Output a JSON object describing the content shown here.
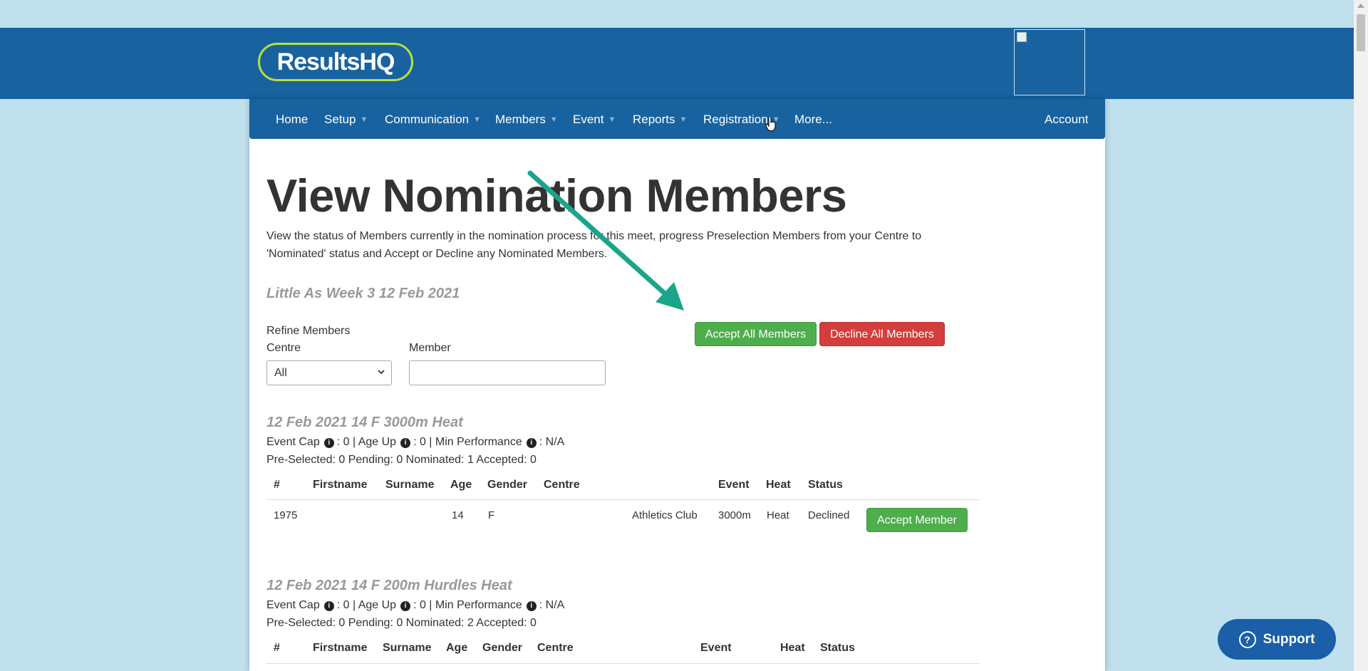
{
  "brand": {
    "logo_text": "ResultsHQ"
  },
  "nav": {
    "items": [
      {
        "label": "Home"
      },
      {
        "label": "Setup"
      },
      {
        "label": "Communication"
      },
      {
        "label": "Members"
      },
      {
        "label": "Event"
      },
      {
        "label": "Reports"
      },
      {
        "label": "Registration"
      },
      {
        "label": "More..."
      }
    ],
    "account": "Account"
  },
  "page": {
    "title": "View Nomination Members",
    "intro": "View the status of Members currently in the nomination process for this meet, progress Preselection Members from your Centre to 'Nominated' status and Accept or Decline any Nominated Members.",
    "meet": "Little As Week 3 12 Feb 2021"
  },
  "filters": {
    "refine_label": "Refine Members",
    "centre_label": "Centre",
    "centre_value": "All",
    "member_label": "Member",
    "member_value": ""
  },
  "actions": {
    "accept_all": "Accept All Members",
    "decline_all": "Decline All Members"
  },
  "table_headers": [
    "#",
    "Firstname",
    "Surname",
    "Age",
    "Gender",
    "Centre",
    "Event",
    "Heat",
    "Status"
  ],
  "events": [
    {
      "title": "12 Feb 2021 14 F 3000m Heat",
      "caps": {
        "event_cap_label": "Event Cap",
        "event_cap": "0",
        "age_up_label": "Age Up",
        "age_up": "0",
        "min_perf_label": "Min Performance",
        "min_perf": "N/A"
      },
      "counts": "Pre-Selected: 0 Pending: 0 Nominated: 1 Accepted: 0",
      "rows": [
        {
          "num": "1975",
          "firstname": "",
          "surname": "",
          "age": "14",
          "gender": "F",
          "centre": "Athletics Club",
          "event": "3000m",
          "heat": "Heat",
          "status": "Declined",
          "action": "Accept Member"
        }
      ]
    },
    {
      "title": "12 Feb 2021 14 F 200m Hurdles Heat",
      "caps": {
        "event_cap_label": "Event Cap",
        "event_cap": "0",
        "age_up_label": "Age Up",
        "age_up": "0",
        "min_perf_label": "Min Performance",
        "min_perf": "N/A"
      },
      "counts": "Pre-Selected: 0 Pending: 0 Nominated: 2 Accepted: 0",
      "rows": []
    }
  ],
  "support": {
    "label": "Support"
  },
  "colors": {
    "header": "#1862a0",
    "accept": "#4eae4c",
    "decline": "#d43d3b",
    "annotation_arrow": "#1aa58a"
  }
}
